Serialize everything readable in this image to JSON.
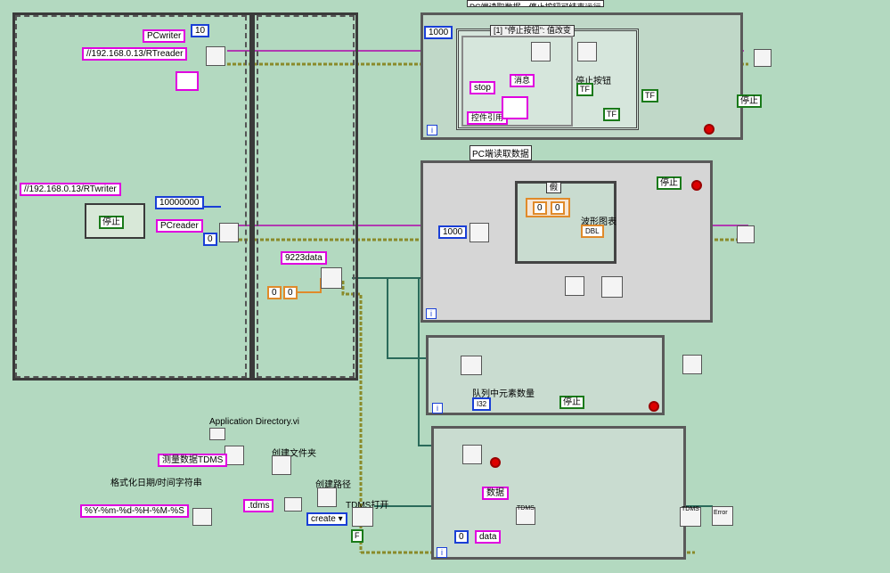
{
  "top_title_fragment": "PC端读取数据，停止按钮可结束运行",
  "seq_frame_left": {
    "pcwriter": "PCwriter",
    "num10": "10",
    "rtreader_url": "//192.168.0.13/RTreader",
    "rtwriter_url": "//192.168.0.13/RTwriter",
    "stop_label": "停止",
    "num_10000000": "10000000",
    "pcreader": "PCreader",
    "num0": "0",
    "data9223": "9223data",
    "zero_a": "0",
    "zero_b": "0"
  },
  "event_loop": {
    "num1000": "1000",
    "case_selector": "[1] \"停止按钮\": 值改变",
    "stop_str": "stop",
    "msg_label": "消息",
    "ctrl_ref_label": "控件引用",
    "stop_btn_label": "停止按钮",
    "stop_ind": "停止",
    "tf1": "TF",
    "tf2": "TF",
    "tf3": "TF",
    "iter_label": "i"
  },
  "read_loop": {
    "title": "PC端读取数据",
    "num1000": "1000",
    "case_selector": "假",
    "zero1": "0",
    "zero2": "0",
    "waveform_label": "波形图表",
    "dbl_label": "DBL",
    "stop_label": "停止",
    "iter_label": "i"
  },
  "queue_loop": {
    "queue_count_label": "队列中元素数量",
    "i32": "I32",
    "stop_label": "停止",
    "iter_label": "i"
  },
  "tdms_loop": {
    "data_label": "数据",
    "zero": "0",
    "data_str": "data",
    "tdms1": "TDMS",
    "tdms2": "TDMS",
    "iter_label": "i",
    "error_label": "Error"
  },
  "file_section": {
    "app_dir_label": "Application Directory.vi",
    "measure_tdms": "测量数据TDMS",
    "create_folder": "创建文件夹",
    "format_label": "格式化日期/时间字符串",
    "create_path": "创建路径",
    "tdms_open": "TDMS打开",
    "format_str": "%Y-%m-%d-%H-%M-%S",
    "ext_tdms": ".tdms",
    "create_enum": "create",
    "f_const": "F"
  }
}
